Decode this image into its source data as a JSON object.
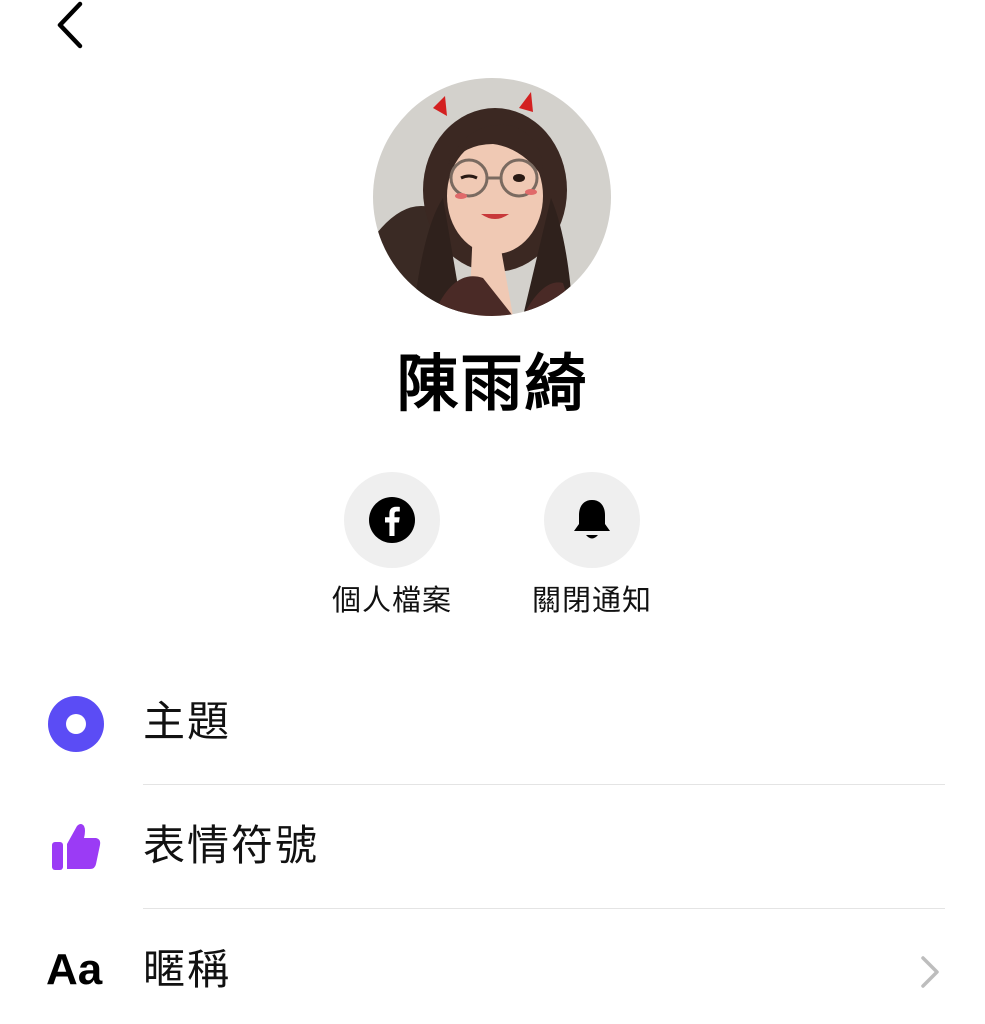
{
  "header": {
    "back_icon": "chevron-left-icon"
  },
  "profile": {
    "name": "陳雨綺",
    "avatar": "profile-photo"
  },
  "actions": [
    {
      "label": "個人檔案",
      "icon": "facebook-icon"
    },
    {
      "label": "關閉通知",
      "icon": "bell-icon"
    }
  ],
  "settings": [
    {
      "label": "主題",
      "icon": "theme-circle-icon",
      "icon_color": "#5b4cf5"
    },
    {
      "label": "表情符號",
      "icon": "thumbs-up-icon",
      "icon_color": "#9b3bf5"
    },
    {
      "label": "暱稱",
      "icon_text": "Aa",
      "chevron_icon": "chevron-right-icon"
    }
  ],
  "colors": {
    "theme_accent": "#5b4cf5",
    "emoji_accent": "#9b3bf5",
    "action_bg": "#efefef"
  }
}
